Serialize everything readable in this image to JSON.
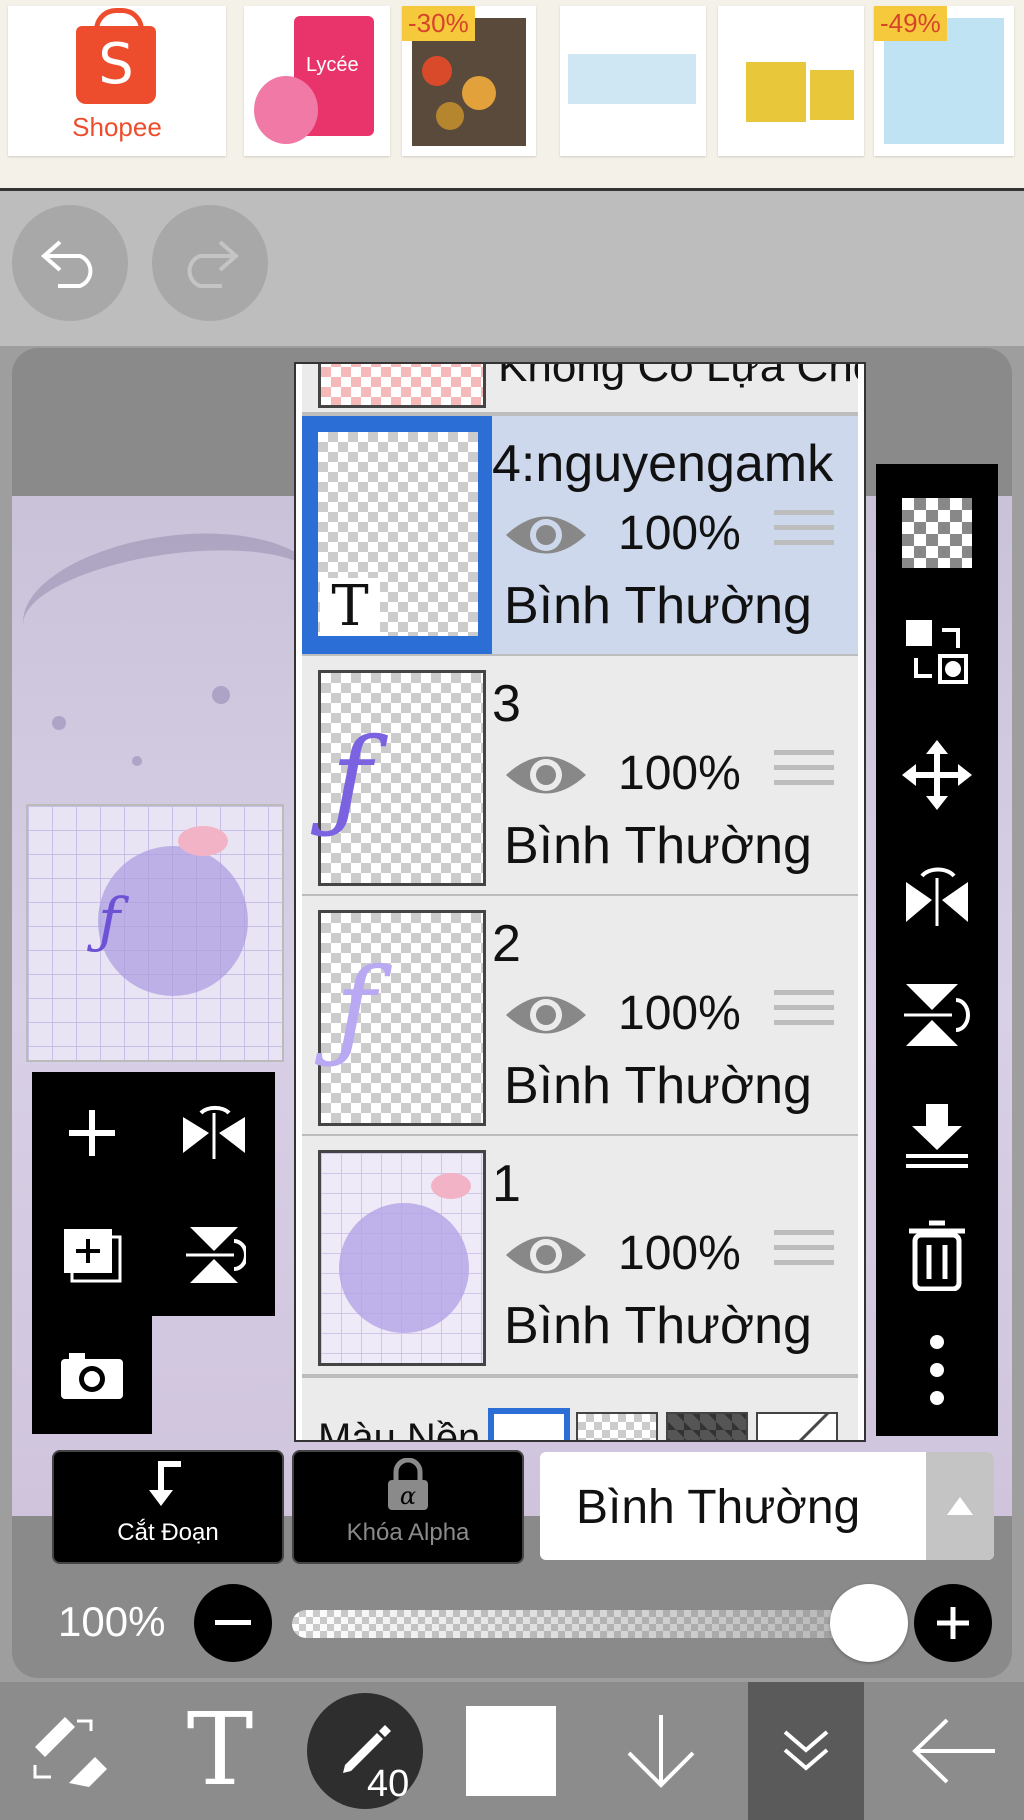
{
  "ad": {
    "brand": "Shopee",
    "product_text": "Lycée",
    "badges": [
      "-30%",
      "-49%"
    ]
  },
  "layers": {
    "no_selection_label": "Không Có Lựa Chọn",
    "items": [
      {
        "name": "4:nguyengamk",
        "opacity": "100%",
        "blend": "Bình Thường",
        "selected": true,
        "text_layer_mark": "T"
      },
      {
        "name": "3",
        "opacity": "100%",
        "blend": "Bình Thường",
        "selected": false
      },
      {
        "name": "2",
        "opacity": "100%",
        "blend": "Bình Thường",
        "selected": false
      },
      {
        "name": "1",
        "opacity": "100%",
        "blend": "Bình Thường",
        "selected": false
      }
    ],
    "background_label": "Màu Nền"
  },
  "controls": {
    "clip_label": "Cắt Đoạn",
    "alpha_lock_label": "Khóa Alpha",
    "blend_mode": "Bình Thường",
    "opacity_label": "100%",
    "opacity_value": 1.0
  },
  "bottom": {
    "brush_size": "40"
  },
  "colors": {
    "selection_blue": "#2b6fd6",
    "panel_bg": "#ebebeb",
    "selected_row_bg": "#cdd8ec",
    "shopee_orange": "#ee4d2d"
  }
}
